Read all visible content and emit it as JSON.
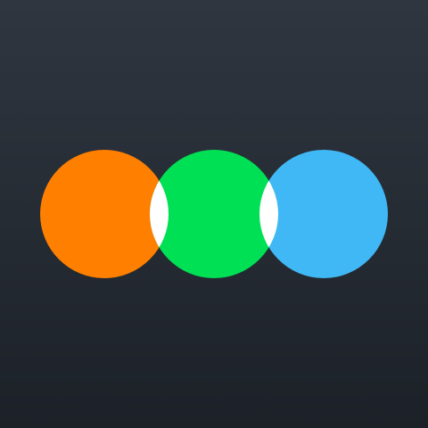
{
  "app_icon": {
    "logo": {
      "circles": [
        {
          "name": "orange",
          "color": "#ff7f00"
        },
        {
          "name": "green",
          "color": "#00e055"
        },
        {
          "name": "blue",
          "color": "#40b8f5"
        }
      ],
      "overlap_color": "#ffffff"
    }
  }
}
